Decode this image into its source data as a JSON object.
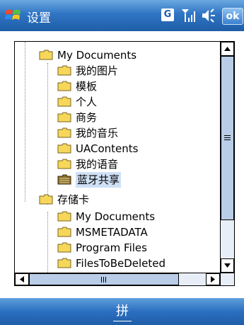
{
  "titlebar": {
    "title": "设置",
    "gprs_letter": "G",
    "ok_label": "ok",
    "icons": [
      "windows-start-icon",
      "gprs-icon",
      "signal-strength-icon",
      "volume-icon"
    ]
  },
  "tree": {
    "items": [
      {
        "label": "My Documents",
        "level": 1
      },
      {
        "label": "我的图片",
        "level": 2
      },
      {
        "label": "模板",
        "level": 2
      },
      {
        "label": "个人",
        "level": 2
      },
      {
        "label": "商务",
        "level": 2
      },
      {
        "label": "我的音乐",
        "level": 2
      },
      {
        "label": "UAContents",
        "level": 2
      },
      {
        "label": "我的语音",
        "level": 2
      },
      {
        "label": "蓝牙共享",
        "level": 2,
        "selected": true,
        "shared": true
      },
      {
        "label": "存储卡",
        "level": 1
      },
      {
        "label": "My Documents",
        "level": 2
      },
      {
        "label": "MSMETADATA",
        "level": 2
      },
      {
        "label": "Program Files",
        "level": 2
      },
      {
        "label": "FilesToBeDeleted",
        "level": 2
      }
    ]
  },
  "softbar": {
    "ime_label": "拼"
  },
  "colors": {
    "titlebar": "#2f74c4",
    "folder": "#f6d75a",
    "selection": "#cfe0f5"
  }
}
